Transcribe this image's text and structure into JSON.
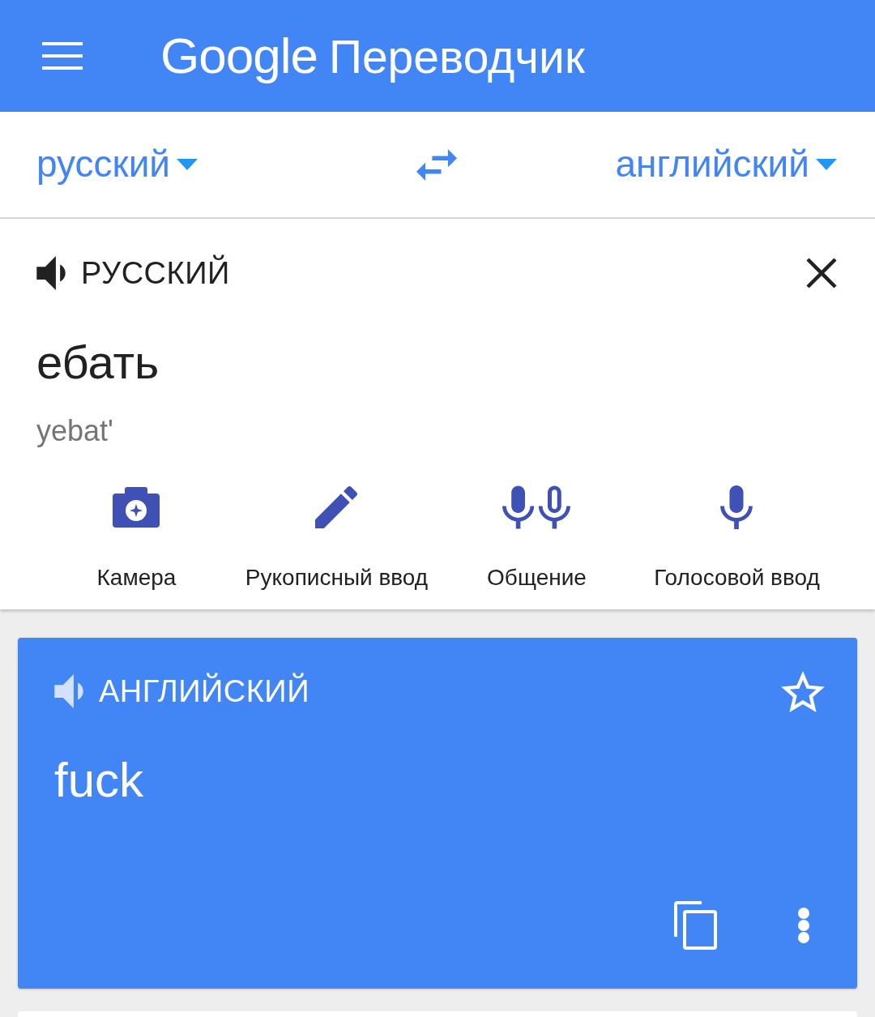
{
  "app_bar": {
    "brand": "Google",
    "title": "Переводчик"
  },
  "language_bar": {
    "source": "русский",
    "target": "английский"
  },
  "input_panel": {
    "language": "РУССКИЙ",
    "text": "ебать",
    "transliteration": "yebat'",
    "tools": [
      {
        "kind": "camera",
        "label": "Камера"
      },
      {
        "kind": "handwriting",
        "label": "Рукописный ввод"
      },
      {
        "kind": "conversation",
        "label": "Общение"
      },
      {
        "kind": "voice",
        "label": "Голосовой ввод"
      }
    ]
  },
  "result_card": {
    "language": "АНГЛИЙСКИЙ",
    "text": "fuck",
    "saved": false
  }
}
